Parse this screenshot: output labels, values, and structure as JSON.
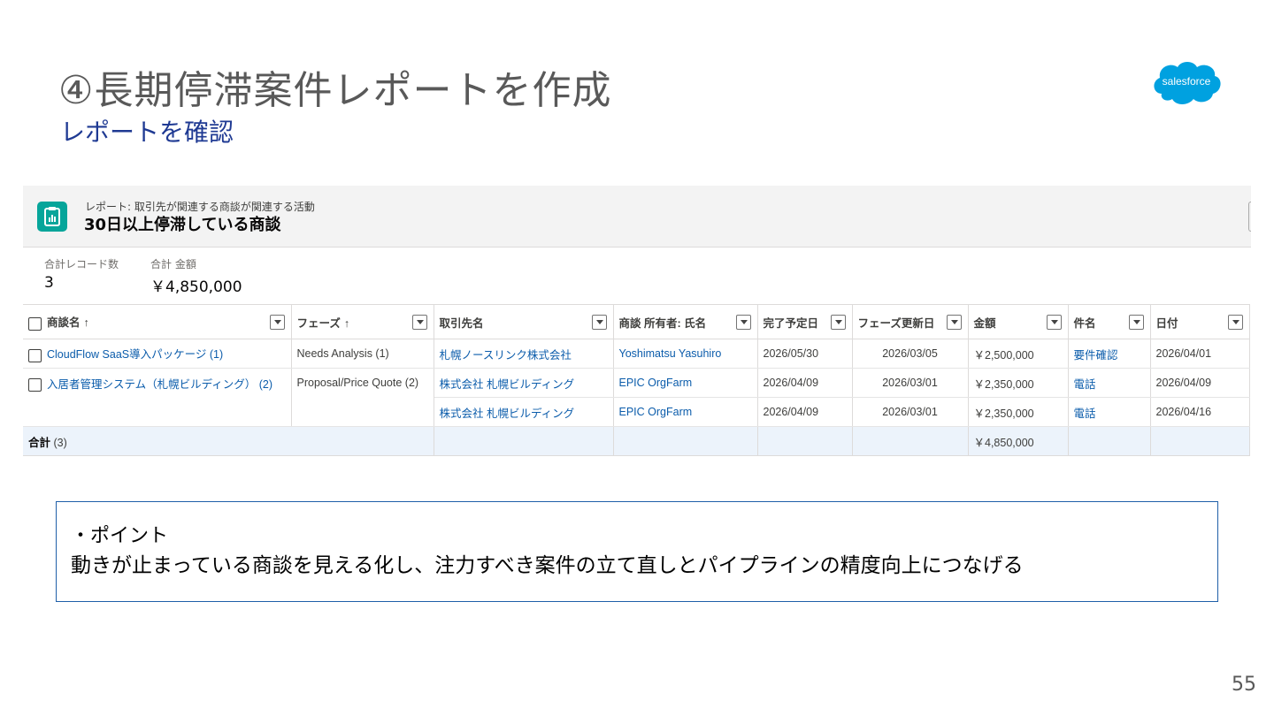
{
  "slide": {
    "title": "④長期停滞案件レポートを作成",
    "subtitle": "レポートを確認",
    "page_number": "55",
    "logo_text": "salesforce"
  },
  "report": {
    "type_label": "レポート: 取引先が関連する商談が関連する活動",
    "name": "30日以上停滞している商談",
    "summary": {
      "count_label": "合計レコード数",
      "count_value": "3",
      "amount_label": "合計 金額",
      "amount_value": "￥4,850,000"
    },
    "columns": [
      {
        "label": "商談名",
        "sort": "↑"
      },
      {
        "label": "フェーズ",
        "sort": "↑"
      },
      {
        "label": "取引先名",
        "sort": ""
      },
      {
        "label": "商談 所有者: 氏名",
        "sort": ""
      },
      {
        "label": "完了予定日",
        "sort": ""
      },
      {
        "label": "フェーズ更新日",
        "sort": ""
      },
      {
        "label": "金額",
        "sort": ""
      },
      {
        "label": "件名",
        "sort": ""
      },
      {
        "label": "日付",
        "sort": ""
      }
    ],
    "rows": [
      {
        "opportunity": "CloudFlow SaaS導入パッケージ (1)",
        "phase": "Needs Analysis (1)",
        "account": "札幌ノースリンク株式会社",
        "owner": "Yoshimatsu Yasuhiro",
        "close_date": "2026/05/30",
        "phase_updated": "2026/03/05",
        "amount": "￥2,500,000",
        "subject": "要件確認",
        "date": "2026/04/01"
      },
      {
        "opportunity": "入居者管理システム（札幌ビルディング） (2)",
        "phase": "Proposal/Price Quote (2)",
        "account": "株式会社 札幌ビルディング",
        "owner": "EPIC OrgFarm",
        "close_date": "2026/04/09",
        "phase_updated": "2026/03/01",
        "amount": "￥2,350,000",
        "subject": "電話",
        "date": "2026/04/09"
      },
      {
        "opportunity": "",
        "phase": "",
        "account": "株式会社 札幌ビルディング",
        "owner": "EPIC OrgFarm",
        "close_date": "2026/04/09",
        "phase_updated": "2026/03/01",
        "amount": "￥2,350,000",
        "subject": "電話",
        "date": "2026/04/16"
      }
    ],
    "total": {
      "label": "合計",
      "count": "(3)",
      "amount": "￥4,850,000"
    }
  },
  "point": {
    "title": "・ポイント",
    "text": "動きが止まっている商談を見える化し、注力すべき案件の立て直しとパイプラインの精度向上につなげる"
  },
  "colors": {
    "accent_teal": "#06a59a",
    "link_blue": "#0b5cab",
    "salesforce_blue": "#00a1e0",
    "subtitle_blue": "#1f3a93",
    "total_row_bg": "#ecf3fb"
  }
}
